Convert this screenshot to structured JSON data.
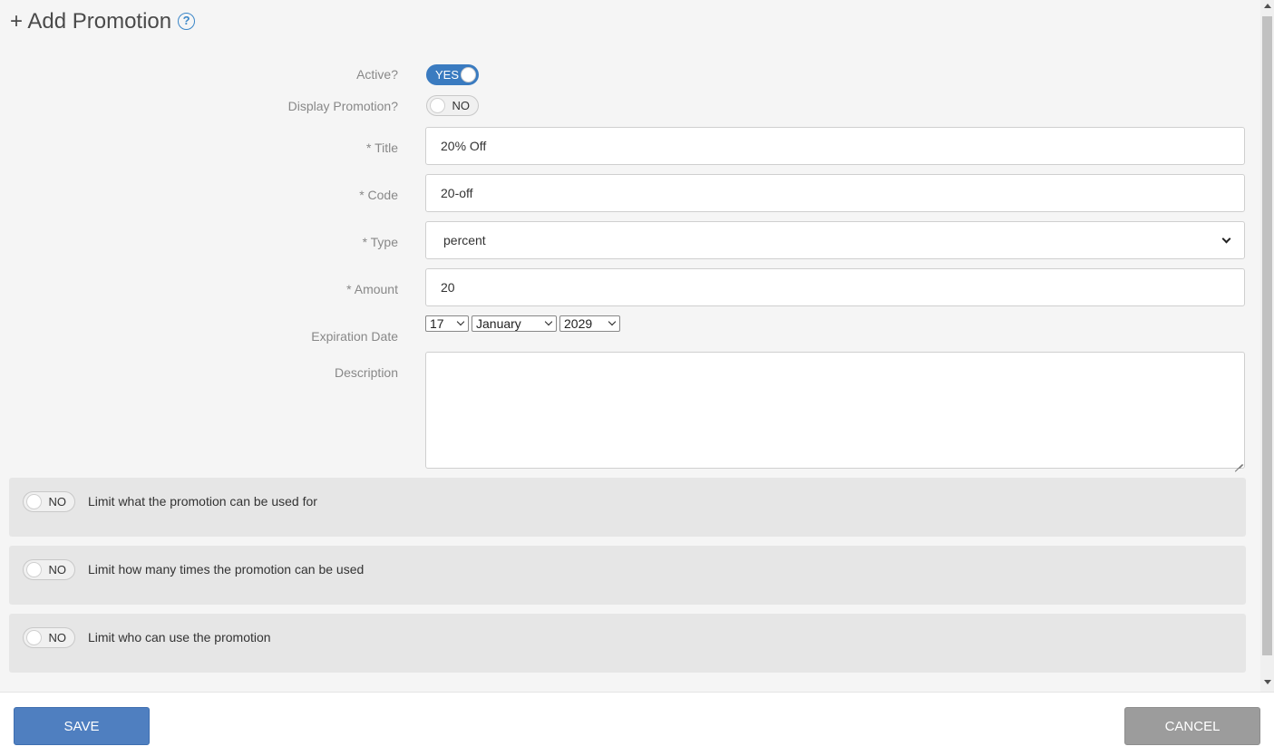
{
  "header": {
    "title": "+ Add Promotion",
    "help_icon": "?"
  },
  "form": {
    "active": {
      "label": "Active?",
      "state": "YES"
    },
    "display": {
      "label": "Display Promotion?",
      "state": "NO"
    },
    "title": {
      "label": "* Title",
      "value": "20% Off"
    },
    "code": {
      "label": "* Code",
      "value": "20-off"
    },
    "type": {
      "label": "* Type",
      "value": "percent"
    },
    "amount": {
      "label": "* Amount",
      "value": "20"
    },
    "expiration": {
      "label": "Expiration Date",
      "day": "17",
      "month": "January",
      "year": "2029"
    },
    "description": {
      "label": "Description",
      "value": ""
    }
  },
  "limits": [
    {
      "state": "NO",
      "label": "Limit what the promotion can be used for"
    },
    {
      "state": "NO",
      "label": "Limit how many times the promotion can be used"
    },
    {
      "state": "NO",
      "label": "Limit who can use the promotion"
    }
  ],
  "footer": {
    "save_label": "SAVE",
    "cancel_label": "CANCEL"
  },
  "colors": {
    "accent": "#3a7bc0",
    "save": "#4f7fc0",
    "cancel": "#9c9c9c",
    "background": "#f5f5f5",
    "panel": "#e6e6e6"
  }
}
